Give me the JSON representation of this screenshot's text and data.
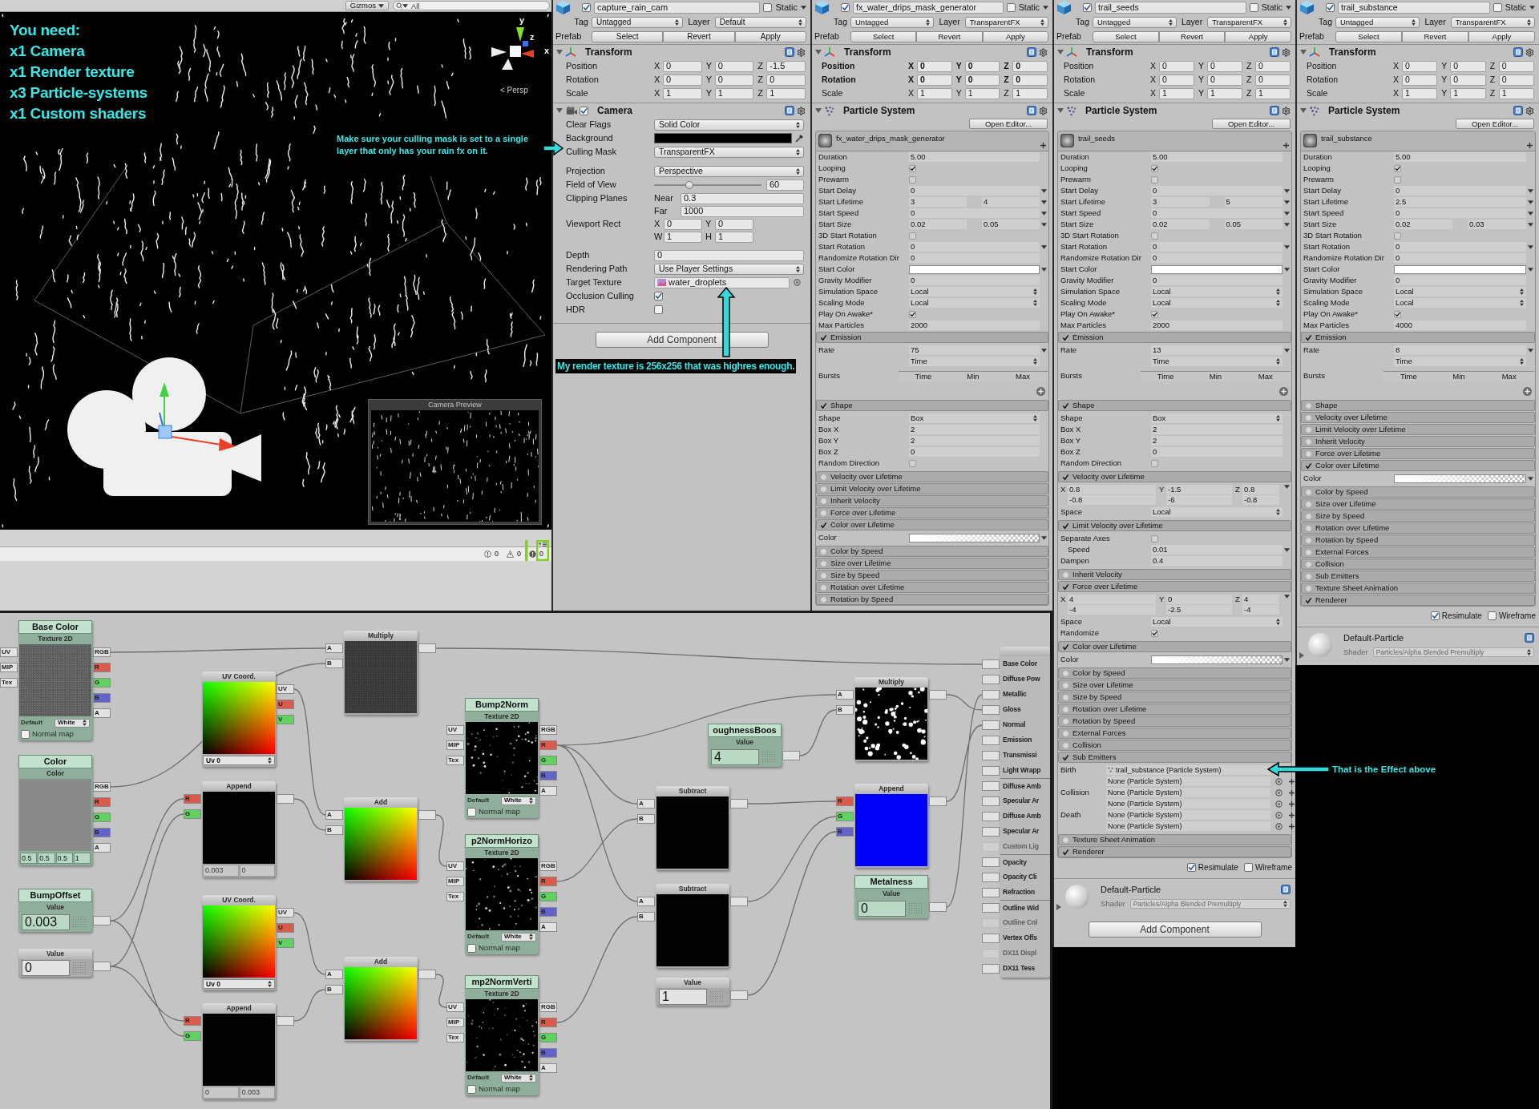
{
  "scene_view": {
    "gizmos_label": "Gizmos",
    "search_placeholder": "All",
    "checklist": [
      "You need:",
      "x1 Camera",
      "x1 Render texture",
      "x3 Particle-systems",
      "x1 Custom shaders"
    ],
    "axis_labels": [
      "y",
      "z",
      "x"
    ],
    "view_label": "< Persp",
    "camera_preview_title": "Camera Preview",
    "console_counts": [
      {
        "kind": "info",
        "count": "0"
      },
      {
        "kind": "warning",
        "count": "0"
      },
      {
        "kind": "error",
        "count": "0"
      }
    ]
  },
  "inspectors": [
    {
      "kind": "camera",
      "object": {
        "active": true,
        "name": "capture_rain_cam",
        "static": false,
        "static_label": "Static",
        "tag_label": "Tag",
        "tag": "Untagged",
        "layer_label": "Layer",
        "layer": "Default",
        "prefab_label": "Prefab",
        "prefab_buttons": [
          "Select",
          "Revert",
          "Apply"
        ]
      },
      "transform": {
        "title": "Transform",
        "rows": [
          {
            "label": "Position",
            "modified": false,
            "values": [
              [
                "X",
                "0"
              ],
              [
                "Y",
                "0"
              ],
              [
                "Z",
                "-1.5"
              ]
            ]
          },
          {
            "label": "Rotation",
            "modified": false,
            "values": [
              [
                "X",
                "0"
              ],
              [
                "Y",
                "0"
              ],
              [
                "Z",
                "0"
              ]
            ]
          },
          {
            "label": "Scale",
            "modified": false,
            "values": [
              [
                "X",
                "1"
              ],
              [
                "Y",
                "1"
              ],
              [
                "Z",
                "1"
              ]
            ]
          }
        ]
      },
      "component": {
        "title": "Camera",
        "enabled": true,
        "groups": [
          [
            {
              "kind": "popup",
              "label": "Clear Flags",
              "value": "Solid Color"
            },
            {
              "kind": "color",
              "label": "Background",
              "color": "#000000"
            },
            {
              "kind": "popup",
              "label": "Culling Mask",
              "value": "TransparentFX"
            }
          ],
          [
            {
              "kind": "popup",
              "label": "Projection",
              "value": "Perspective"
            },
            {
              "kind": "slider",
              "label": "Field of View",
              "level": 0.33,
              "value": "60"
            },
            {
              "kind": "pairs",
              "label": "Clipping Planes",
              "pairs": [
                [
                  "Near",
                  "0.3"
                ],
                [
                  "Far",
                  "1000"
                ]
              ]
            },
            {
              "kind": "rect",
              "label": "Viewport Rect",
              "pairs": [
                [
                  "X",
                  "0"
                ],
                [
                  "Y",
                  "0"
                ],
                [
                  "W",
                  "1"
                ],
                [
                  "H",
                  "1"
                ]
              ]
            }
          ],
          [
            {
              "kind": "text",
              "label": "Depth",
              "value": "0"
            },
            {
              "kind": "popup",
              "label": "Rendering Path",
              "value": "Use Player Settings"
            },
            {
              "kind": "object",
              "label": "Target Texture",
              "value": "water_droplets"
            },
            {
              "kind": "check",
              "label": "Occlusion Culling",
              "checked": true
            },
            {
              "kind": "check",
              "label": "HDR",
              "checked": false
            }
          ]
        ]
      },
      "add_component": "Add Component"
    },
    {
      "kind": "particle_system",
      "object": {
        "active": true,
        "name": "fx_water_drips_mask_generator",
        "static": false,
        "static_label": "Static",
        "tag_label": "Tag",
        "tag": "Untagged",
        "layer_label": "Layer",
        "layer": "TransparentFX",
        "prefab_label": "Prefab",
        "prefab_buttons": [
          "Select",
          "Revert",
          "Apply"
        ]
      },
      "transform": {
        "title": "Transform",
        "rows": [
          {
            "label": "Position",
            "modified": true,
            "values": [
              [
                "X",
                "0"
              ],
              [
                "Y",
                "0"
              ],
              [
                "Z",
                "0"
              ]
            ]
          },
          {
            "label": "Rotation",
            "modified": true,
            "values": [
              [
                "X",
                "0"
              ],
              [
                "Y",
                "0"
              ],
              [
                "Z",
                "0"
              ]
            ]
          },
          {
            "label": "Scale",
            "modified": false,
            "values": [
              [
                "X",
                "1"
              ],
              [
                "Y",
                "1"
              ],
              [
                "Z",
                "1"
              ]
            ]
          }
        ]
      },
      "component": {
        "title": "Particle System",
        "open_editor": "Open Editor...",
        "system_name": "fx_water_drips_mask_generator",
        "main": [
          {
            "kind": "text",
            "label": "Duration",
            "value": "5.00"
          },
          {
            "kind": "check",
            "label": "Looping",
            "checked": true
          },
          {
            "kind": "check",
            "label": "Prewarm",
            "checked": false
          },
          {
            "kind": "curve",
            "label": "Start Delay",
            "value": "0"
          },
          {
            "kind": "range",
            "label": "Start Lifetime",
            "values": [
              "3",
              "4"
            ]
          },
          {
            "kind": "curve",
            "label": "Start Speed",
            "value": "0"
          },
          {
            "kind": "range",
            "label": "Start Size",
            "values": [
              "0.02",
              "0.05"
            ]
          },
          {
            "kind": "check",
            "label": "3D Start Rotation",
            "checked": false
          },
          {
            "kind": "curve",
            "label": "Start Rotation",
            "value": "0"
          },
          {
            "kind": "text",
            "label": "Randomize Rotation Dir",
            "value": "0"
          },
          {
            "kind": "color",
            "label": "Start Color",
            "color": "#ffffff"
          },
          {
            "kind": "text",
            "label": "Gravity Modifier",
            "value": "0"
          },
          {
            "kind": "popup",
            "label": "Simulation Space",
            "value": "Local"
          },
          {
            "kind": "popup",
            "label": "Scaling Mode",
            "value": "Local"
          },
          {
            "kind": "check",
            "label": "Play On Awake*",
            "checked": true
          },
          {
            "kind": "text",
            "label": "Max Particles",
            "value": "2000"
          }
        ],
        "modules": [
          {
            "title": "Emission",
            "enabled": true,
            "rows": [
              {
                "kind": "curve",
                "label": "Rate",
                "value": "75"
              },
              {
                "kind": "popup",
                "value": "Time"
              },
              {
                "kind": "bursts",
                "label": "Bursts",
                "columns": [
                  "Time",
                  "Min",
                  "Max"
                ]
              }
            ]
          },
          {
            "title": "Shape",
            "enabled": true,
            "rows": [
              {
                "kind": "popup",
                "label": "Shape",
                "value": "Box"
              },
              {
                "kind": "text",
                "label": "Box X",
                "value": "2"
              },
              {
                "kind": "text",
                "label": "Box Y",
                "value": "2"
              },
              {
                "kind": "text",
                "label": "Box Z",
                "value": "0"
              },
              {
                "kind": "check",
                "label": "Random Direction",
                "checked": false
              }
            ]
          },
          {
            "title": "Velocity over Lifetime",
            "enabled": false
          },
          {
            "title": "Limit Velocity over Lifetime",
            "enabled": false
          },
          {
            "title": "Inherit Velocity",
            "enabled": false
          },
          {
            "title": "Force over Lifetime",
            "enabled": false
          },
          {
            "title": "Color over Lifetime",
            "enabled": true,
            "rows": [
              {
                "kind": "gradient",
                "label": "Color"
              }
            ]
          },
          {
            "title": "Color by Speed",
            "enabled": false
          },
          {
            "title": "Size over Lifetime",
            "enabled": false
          },
          {
            "title": "Size by Speed",
            "enabled": false
          },
          {
            "title": "Rotation over Lifetime",
            "enabled": false
          },
          {
            "title": "Rotation by Speed",
            "enabled": false
          }
        ]
      }
    },
    {
      "kind": "particle_system",
      "object": {
        "active": true,
        "name": "trail_seeds",
        "static": false,
        "static_label": "Static",
        "tag_label": "Tag",
        "tag": "Untagged",
        "layer_label": "Layer",
        "layer": "TransparentFX",
        "prefab_label": "Prefab",
        "prefab_buttons": [
          "Select",
          "Revert",
          "Apply"
        ]
      },
      "transform": {
        "title": "Transform",
        "rows": [
          {
            "label": "Position",
            "modified": false,
            "values": [
              [
                "X",
                "0"
              ],
              [
                "Y",
                "0"
              ],
              [
                "Z",
                "0"
              ]
            ]
          },
          {
            "label": "Rotation",
            "modified": false,
            "values": [
              [
                "X",
                "0"
              ],
              [
                "Y",
                "0"
              ],
              [
                "Z",
                "0"
              ]
            ]
          },
          {
            "label": "Scale",
            "modified": false,
            "values": [
              [
                "X",
                "1"
              ],
              [
                "Y",
                "1"
              ],
              [
                "Z",
                "1"
              ]
            ]
          }
        ]
      },
      "component": {
        "title": "Particle System",
        "open_editor": "Open Editor...",
        "system_name": "trail_seeds",
        "main": [
          {
            "kind": "text",
            "label": "Duration",
            "value": "5.00"
          },
          {
            "kind": "check",
            "label": "Looping",
            "checked": true
          },
          {
            "kind": "check",
            "label": "Prewarm",
            "checked": false
          },
          {
            "kind": "curve",
            "label": "Start Delay",
            "value": "0"
          },
          {
            "kind": "range",
            "label": "Start Lifetime",
            "values": [
              "3",
              "5"
            ]
          },
          {
            "kind": "curve",
            "label": "Start Speed",
            "value": "0"
          },
          {
            "kind": "range",
            "label": "Start Size",
            "values": [
              "0.02",
              "0.05"
            ]
          },
          {
            "kind": "check",
            "label": "3D Start Rotation",
            "checked": false
          },
          {
            "kind": "curve",
            "label": "Start Rotation",
            "value": "0"
          },
          {
            "kind": "text",
            "label": "Randomize Rotation Dir",
            "value": "0"
          },
          {
            "kind": "color",
            "label": "Start Color",
            "color": "#ffffff"
          },
          {
            "kind": "text",
            "label": "Gravity Modifier",
            "value": "0"
          },
          {
            "kind": "popup",
            "label": "Simulation Space",
            "value": "Local"
          },
          {
            "kind": "popup",
            "label": "Scaling Mode",
            "value": "Local"
          },
          {
            "kind": "check",
            "label": "Play On Awake*",
            "checked": true
          },
          {
            "kind": "text",
            "label": "Max Particles",
            "value": "2000"
          }
        ],
        "modules": [
          {
            "title": "Emission",
            "enabled": true,
            "rows": [
              {
                "kind": "curve",
                "label": "Rate",
                "value": "13"
              },
              {
                "kind": "popup",
                "value": "Time"
              },
              {
                "kind": "bursts",
                "label": "Bursts",
                "columns": [
                  "Time",
                  "Min",
                  "Max"
                ]
              }
            ]
          },
          {
            "title": "Shape",
            "enabled": true,
            "rows": [
              {
                "kind": "popup",
                "label": "Shape",
                "value": "Box"
              },
              {
                "kind": "text",
                "label": "Box X",
                "value": "2"
              },
              {
                "kind": "text",
                "label": "Box Y",
                "value": "2"
              },
              {
                "kind": "text",
                "label": "Box Z",
                "value": "0"
              },
              {
                "kind": "check",
                "label": "Random Direction",
                "checked": false
              }
            ]
          },
          {
            "title": "Velocity over Lifetime",
            "enabled": true,
            "rows": [
              {
                "kind": "xyz",
                "values": [
                  [
                    "X",
                    "0.8",
                    "-0.8"
                  ],
                  [
                    "Y",
                    "-1.5",
                    "-6"
                  ],
                  [
                    "Z",
                    "0.8",
                    "-0.8"
                  ]
                ]
              },
              {
                "kind": "popup",
                "label": "Space",
                "value": "Local"
              }
            ]
          },
          {
            "title": "Limit Velocity over Lifetime",
            "enabled": true,
            "rows": [
              {
                "kind": "check",
                "label": "Separate Axes",
                "checked": false
              },
              {
                "kind": "curve",
                "label": "Speed",
                "value": "0.01",
                "indented": true
              },
              {
                "kind": "text",
                "label": "Dampen",
                "value": "0.4"
              }
            ]
          },
          {
            "title": "Inherit Velocity",
            "enabled": false
          },
          {
            "title": "Force over Lifetime",
            "enabled": true,
            "rows": [
              {
                "kind": "xyz",
                "values": [
                  [
                    "X",
                    "4",
                    "-4"
                  ],
                  [
                    "Y",
                    "0",
                    "-2.5"
                  ],
                  [
                    "Z",
                    "4",
                    "-4"
                  ]
                ]
              },
              {
                "kind": "popup",
                "label": "Space",
                "value": "Local"
              },
              {
                "kind": "check",
                "label": "Randomize",
                "checked": true
              }
            ]
          },
          {
            "title": "Color over Lifetime",
            "enabled": true,
            "rows": [
              {
                "kind": "gradient",
                "label": "Color"
              }
            ]
          },
          {
            "title": "Color by Speed",
            "enabled": false
          },
          {
            "title": "Size over Lifetime",
            "enabled": false
          },
          {
            "title": "Size by Speed",
            "enabled": false
          },
          {
            "title": "Rotation over Lifetime",
            "enabled": false
          },
          {
            "title": "Rotation by Speed",
            "enabled": false
          },
          {
            "title": "External Forces",
            "enabled": false
          },
          {
            "title": "Collision",
            "enabled": false
          },
          {
            "title": "Sub Emitters",
            "enabled": true,
            "rows": [
              {
                "kind": "emitter",
                "label": "Birth",
                "value": "trail_substance (Particle System)",
                "assigned": true
              },
              {
                "kind": "emitter",
                "value": "None (Particle System)",
                "assigned": false
              },
              {
                "kind": "emitter",
                "label": "Collision",
                "value": "None (Particle System)",
                "assigned": false
              },
              {
                "kind": "emitter",
                "value": "None (Particle System)",
                "assigned": false
              },
              {
                "kind": "emitter",
                "label": "Death",
                "value": "None (Particle System)",
                "assigned": false
              },
              {
                "kind": "emitter",
                "value": "None (Particle System)",
                "assigned": false
              }
            ]
          },
          {
            "title": "Texture Sheet Animation",
            "enabled": false
          },
          {
            "title": "Renderer",
            "enabled": true
          }
        ]
      },
      "renderer_footer": {
        "resimulate_label": "Resimulate",
        "resimulate": true,
        "wireframe_label": "Wireframe",
        "wireframe": false
      },
      "material": {
        "name": "Default-Particle",
        "shader_label": "Shader",
        "shader": "Particles/Alpha Blended Premultiply"
      },
      "add_component": "Add Component"
    },
    {
      "kind": "particle_system",
      "object": {
        "active": true,
        "name": "trail_substance",
        "static": false,
        "static_label": "Static",
        "tag_label": "Tag",
        "tag": "Untagged",
        "layer_label": "Layer",
        "layer": "TransparentFX",
        "prefab_label": "Prefab",
        "prefab_buttons": [
          "Select",
          "Revert",
          "Apply"
        ]
      },
      "transform": {
        "title": "Transform",
        "rows": [
          {
            "label": "Position",
            "modified": false,
            "values": [
              [
                "X",
                "0"
              ],
              [
                "Y",
                "0"
              ],
              [
                "Z",
                "0"
              ]
            ]
          },
          {
            "label": "Rotation",
            "modified": false,
            "values": [
              [
                "X",
                "0"
              ],
              [
                "Y",
                "0"
              ],
              [
                "Z",
                "0"
              ]
            ]
          },
          {
            "label": "Scale",
            "modified": false,
            "values": [
              [
                "X",
                "1"
              ],
              [
                "Y",
                "1"
              ],
              [
                "Z",
                "1"
              ]
            ]
          }
        ]
      },
      "component": {
        "title": "Particle System",
        "open_editor": "Open Editor...",
        "system_name": "trail_substance",
        "main": [
          {
            "kind": "text",
            "label": "Duration",
            "value": "5.00"
          },
          {
            "kind": "check",
            "label": "Looping",
            "checked": true
          },
          {
            "kind": "check",
            "label": "Prewarm",
            "checked": false
          },
          {
            "kind": "curve",
            "label": "Start Delay",
            "value": "0"
          },
          {
            "kind": "curve",
            "label": "Start Lifetime",
            "value": "2.5"
          },
          {
            "kind": "curve",
            "label": "Start Speed",
            "value": "0"
          },
          {
            "kind": "range",
            "label": "Start Size",
            "values": [
              "0.02",
              "0.03"
            ]
          },
          {
            "kind": "check",
            "label": "3D Start Rotation",
            "checked": false
          },
          {
            "kind": "curve",
            "label": "Start Rotation",
            "value": "0"
          },
          {
            "kind": "text",
            "label": "Randomize Rotation Dir",
            "value": "0"
          },
          {
            "kind": "color",
            "label": "Start Color",
            "color": "#ffffff"
          },
          {
            "kind": "text",
            "label": "Gravity Modifier",
            "value": "0"
          },
          {
            "kind": "popup",
            "label": "Simulation Space",
            "value": "Local"
          },
          {
            "kind": "popup",
            "label": "Scaling Mode",
            "value": "Local"
          },
          {
            "kind": "check",
            "label": "Play On Awake*",
            "checked": true
          },
          {
            "kind": "text",
            "label": "Max Particles",
            "value": "4000"
          }
        ],
        "modules": [
          {
            "title": "Emission",
            "enabled": true,
            "rows": [
              {
                "kind": "curve",
                "label": "Rate",
                "value": "8"
              },
              {
                "kind": "popup",
                "value": "Time"
              },
              {
                "kind": "bursts",
                "label": "Bursts",
                "columns": [
                  "Time",
                  "Min",
                  "Max"
                ]
              }
            ]
          },
          {
            "title": "Shape",
            "enabled": false
          },
          {
            "title": "Velocity over Lifetime",
            "enabled": false
          },
          {
            "title": "Limit Velocity over Lifetime",
            "enabled": false
          },
          {
            "title": "Inherit Velocity",
            "enabled": false
          },
          {
            "title": "Force over Lifetime",
            "enabled": false
          },
          {
            "title": "Color over Lifetime",
            "enabled": true,
            "rows": [
              {
                "kind": "gradient",
                "label": "Color"
              }
            ]
          },
          {
            "title": "Color by Speed",
            "enabled": false
          },
          {
            "title": "Size over Lifetime",
            "enabled": false
          },
          {
            "title": "Size by Speed",
            "enabled": false
          },
          {
            "title": "Rotation over Lifetime",
            "enabled": false
          },
          {
            "title": "Rotation by Speed",
            "enabled": false
          },
          {
            "title": "External Forces",
            "enabled": false
          },
          {
            "title": "Collision",
            "enabled": false
          },
          {
            "title": "Sub Emitters",
            "enabled": false
          },
          {
            "title": "Texture Sheet Animation",
            "enabled": false
          },
          {
            "title": "Renderer",
            "enabled": true
          }
        ]
      },
      "renderer_footer": {
        "resimulate_label": "Resimulate",
        "resimulate": true,
        "wireframe_label": "Wireframe",
        "wireframe": false
      },
      "material": {
        "name": "Default-Particle",
        "shader_label": "Shader",
        "shader": "Particles/Alpha Blended Premultiply"
      }
    }
  ],
  "node_graph": {
    "nodes": [
      {
        "kind": "texture",
        "title": "Base Color",
        "header": "Texture 2D",
        "preview": {
          "kind": "noise"
        },
        "inputs": [
          {
            "label": "UV"
          },
          {
            "label": "MIP"
          },
          {
            "label": "Tex"
          }
        ],
        "outputs": [
          {
            "label": "RGB"
          },
          {
            "label": "R",
            "color": "#d95b4b"
          },
          {
            "label": "G",
            "color": "#5fd25f"
          },
          {
            "label": "B",
            "color": "#6464c8"
          },
          {
            "label": "A"
          }
        ],
        "default_label": "Default",
        "default_value": "White",
        "normal_map_label": "Normal map",
        "normal_map": false
      },
      {
        "kind": "color",
        "title": "Color",
        "header": "Color",
        "preview": {
          "kind": "flat"
        },
        "outputs": [
          {
            "label": "RGB"
          },
          {
            "label": "R",
            "color": "#d95b4b"
          },
          {
            "label": "G",
            "color": "#5fd25f"
          },
          {
            "label": "B",
            "color": "#6464c8"
          },
          {
            "label": "A"
          }
        ],
        "values": [
          "0.5",
          "0.5",
          "0.5",
          "1"
        ]
      },
      {
        "kind": "value",
        "title": "BumpOffset",
        "header": "Value",
        "value": "0.003"
      },
      {
        "kind": "value",
        "header": "Value",
        "value": "0"
      },
      {
        "kind": "uv",
        "header": "UV Coord.",
        "preview": {
          "kind": "uv"
        },
        "outputs": [
          {
            "label": "UV"
          },
          {
            "label": "U",
            "color": "#d95b4b"
          },
          {
            "label": "V",
            "color": "#5fd25f"
          }
        ],
        "channel": "Uv 0"
      },
      {
        "kind": "append",
        "header": "Append",
        "preview": {
          "kind": "blank"
        },
        "inputs": [
          {
            "label": "R",
            "color": "#d95b4b"
          },
          {
            "label": "G",
            "color": "#5fd25f"
          }
        ],
        "values": [
          "0.003",
          "0"
        ]
      },
      {
        "kind": "uv",
        "header": "UV Coord.",
        "preview": {
          "kind": "uv"
        },
        "outputs": [
          {
            "label": "UV"
          },
          {
            "label": "U",
            "color": "#d95b4b"
          },
          {
            "label": "V",
            "color": "#5fd25f"
          }
        ],
        "channel": "Uv 0"
      },
      {
        "kind": "append",
        "header": "Append",
        "preview": {
          "kind": "blank"
        },
        "inputs": [
          {
            "label": "R",
            "color": "#d95b4b"
          },
          {
            "label": "G",
            "color": "#5fd25f"
          }
        ],
        "values": [
          "0",
          "0.003"
        ]
      },
      {
        "kind": "operator",
        "header": "Multiply",
        "preview": {
          "kind": "dark_noise"
        },
        "inputs": [
          {
            "label": "A"
          },
          {
            "label": "B"
          }
        ]
      },
      {
        "kind": "operator",
        "header": "Add",
        "preview": {
          "kind": "uv"
        },
        "inputs": [
          {
            "label": "A"
          },
          {
            "label": "B"
          }
        ]
      },
      {
        "kind": "operator",
        "header": "Add",
        "preview": {
          "kind": "uv"
        },
        "inputs": [
          {
            "label": "A"
          },
          {
            "label": "B"
          }
        ]
      },
      {
        "kind": "texture",
        "title": "Bump2Norm",
        "header": "Texture 2D",
        "preview": {
          "kind": "dots"
        },
        "inputs": [
          {
            "label": "UV"
          },
          {
            "label": "MIP"
          },
          {
            "label": "Tex"
          }
        ],
        "outputs": [
          {
            "label": "RGB"
          },
          {
            "label": "R",
            "color": "#d95b4b"
          },
          {
            "label": "G",
            "color": "#5fd25f"
          },
          {
            "label": "B",
            "color": "#6464c8"
          },
          {
            "label": "A"
          }
        ],
        "default_label": "Default",
        "default_value": "White",
        "normal_map_label": "Normal map",
        "normal_map": false
      },
      {
        "kind": "texture",
        "title": "p2NormHorizo",
        "header": "Texture 2D",
        "preview": {
          "kind": "dots"
        },
        "inputs": [
          {
            "label": "UV"
          },
          {
            "label": "MIP"
          },
          {
            "label": "Tex"
          }
        ],
        "outputs": [
          {
            "label": "RGB"
          },
          {
            "label": "R",
            "color": "#d95b4b"
          },
          {
            "label": "G",
            "color": "#5fd25f"
          },
          {
            "label": "B",
            "color": "#6464c8"
          },
          {
            "label": "A"
          }
        ],
        "default_label": "Default",
        "default_value": "White",
        "normal_map_label": "Normal map",
        "normal_map": false
      },
      {
        "kind": "texture",
        "title": "mp2NormVerti",
        "header": "Texture 2D",
        "preview": {
          "kind": "dots"
        },
        "inputs": [
          {
            "label": "UV"
          },
          {
            "label": "MIP"
          },
          {
            "label": "Tex"
          }
        ],
        "outputs": [
          {
            "label": "RGB"
          },
          {
            "label": "R",
            "color": "#d95b4b"
          },
          {
            "label": "G",
            "color": "#5fd25f"
          },
          {
            "label": "B",
            "color": "#6464c8"
          },
          {
            "label": "A"
          }
        ],
        "default_label": "Default",
        "default_value": "White",
        "normal_map_label": "Normal map",
        "normal_map": false
      },
      {
        "kind": "operator",
        "header": "Multiply",
        "preview": {
          "kind": "bright_dots"
        },
        "inputs": [
          {
            "label": "A"
          },
          {
            "label": "B"
          }
        ]
      },
      {
        "kind": "value",
        "title": "oughnessBoos",
        "header": "Value",
        "value": "4"
      },
      {
        "kind": "operator",
        "header": "Subtract",
        "preview": {
          "kind": "blank"
        },
        "inputs": [
          {
            "label": "A"
          },
          {
            "label": "B"
          }
        ]
      },
      {
        "kind": "operator",
        "header": "Subtract",
        "preview": {
          "kind": "blank"
        },
        "inputs": [
          {
            "label": "A"
          },
          {
            "label": "B"
          }
        ]
      },
      {
        "kind": "value",
        "header": "Value",
        "value": "1"
      },
      {
        "kind": "append",
        "header": "Append",
        "preview": {
          "kind": "solid"
        },
        "inputs": [
          {
            "label": "R",
            "color": "#d95b4b"
          },
          {
            "label": "G",
            "color": "#5fd25f"
          },
          {
            "label": "B",
            "color": "#6464c8"
          }
        ]
      },
      {
        "kind": "value",
        "title": "Metalness",
        "header": "Value",
        "value": "0"
      },
      {
        "kind": "main",
        "input_groups": [
          [
            {
              "label": "Base Color",
              "disabled": false
            },
            {
              "label": "Diffuse Pow",
              "disabled": false
            },
            {
              "label": "Metallic",
              "disabled": false
            },
            {
              "label": "Gloss",
              "disabled": false
            },
            {
              "label": "Normal",
              "disabled": false
            },
            {
              "label": "Emission",
              "disabled": false
            },
            {
              "label": "Transmissi",
              "disabled": false
            },
            {
              "label": "Light Wrapp",
              "disabled": false
            }
          ],
          [
            {
              "label": "Diffuse Amb",
              "disabled": false
            },
            {
              "label": "Specular Ar",
              "disabled": false
            },
            {
              "label": "Diffuse Amb",
              "disabled": false
            },
            {
              "label": "Specular Ar",
              "disabled": false
            },
            {
              "label": "Custom Lig",
              "disabled": true
            }
          ],
          [
            {
              "label": "Opacity",
              "disabled": false
            },
            {
              "label": "Opacity Cli",
              "disabled": false
            },
            {
              "label": "Refraction",
              "disabled": false
            }
          ],
          [
            {
              "label": "Outline Wid",
              "disabled": false
            },
            {
              "label": "Outline Col",
              "disabled": true
            },
            {
              "label": "Vertex Offs",
              "disabled": false
            },
            {
              "label": "DX11 Displ",
              "disabled": true
            },
            {
              "label": "DX11 Tess",
              "disabled": false
            }
          ]
        ]
      }
    ]
  },
  "annotations": [
    {
      "text": "Make sure your culling mask is set to a single layer that only has your rain fx on it."
    },
    {
      "text": "My render texture is 256x256 that was highres enough."
    },
    {
      "text": "That is the Effect above"
    }
  ]
}
